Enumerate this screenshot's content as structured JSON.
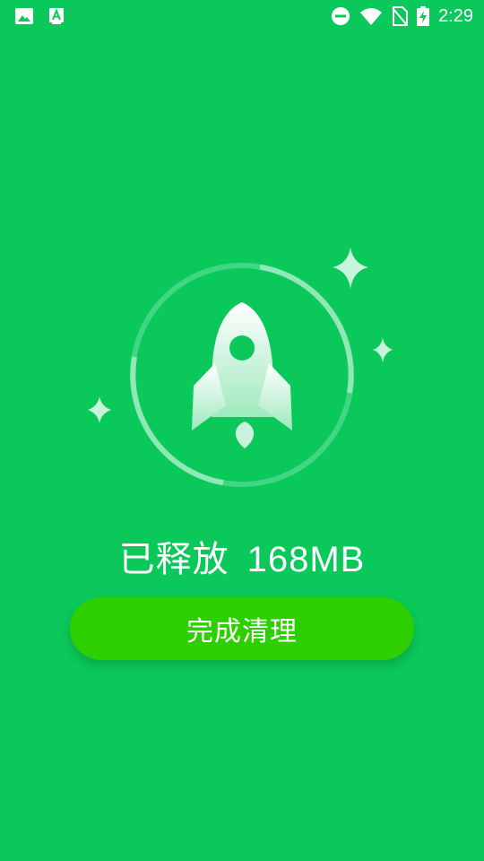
{
  "status_bar": {
    "time": "2:29",
    "icons": [
      "image-icon",
      "a11y-a-icon",
      "dnd-icon",
      "wifi-icon",
      "no-sim-icon",
      "battery-charging-icon"
    ]
  },
  "main": {
    "released_label": "已释放",
    "released_value": "168MB"
  },
  "actions": {
    "finish_label": "完成清理"
  },
  "colors": {
    "background": "#0ac85a",
    "button": "#2ecf00",
    "ring": "#7ae3a6"
  }
}
